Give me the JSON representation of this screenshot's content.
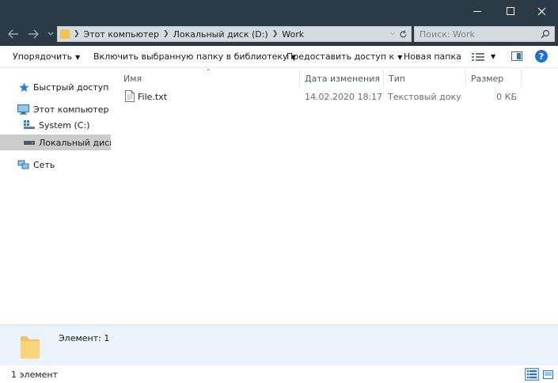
{
  "address": {
    "crumbs": [
      "Этот компьютер",
      "Локальный диск (D:)",
      "Work"
    ]
  },
  "search": {
    "placeholder": "Поиск: Work"
  },
  "commands": {
    "organize": "Упорядочить",
    "include_library": "Включить выбранную папку в библиотеку",
    "share": "Предоставить доступ к",
    "new_folder": "Новая папка"
  },
  "help_label": "?",
  "nav": {
    "items": [
      {
        "label": "Быстрый доступ",
        "icon": "star-icon"
      },
      {
        "label": "Этот компьютер",
        "icon": "computer-icon"
      },
      {
        "label": "System (C:)",
        "icon": "system-drive-icon"
      },
      {
        "label": "Локальный диск (D:)",
        "icon": "drive-icon",
        "selected": true
      },
      {
        "label": "Сеть",
        "icon": "network-icon"
      }
    ]
  },
  "columns": {
    "name": "Имя",
    "date": "Дата изменения",
    "type": "Тип",
    "size": "Размер"
  },
  "files": [
    {
      "name": "File.txt",
      "date": "14.02.2020 18:17",
      "type": "Текстовый документ",
      "size": "0 КБ",
      "icon": "text-file-icon"
    }
  ],
  "details": {
    "text": "Элемент: 1"
  },
  "status": {
    "text": "1 элемент"
  },
  "colors": {
    "titlebar": "#2b3a44",
    "address_bg": "#d6dbdf",
    "accent": "#1e6fd0",
    "details_bg": "#eaf2fa",
    "folder": "#f1c453"
  }
}
